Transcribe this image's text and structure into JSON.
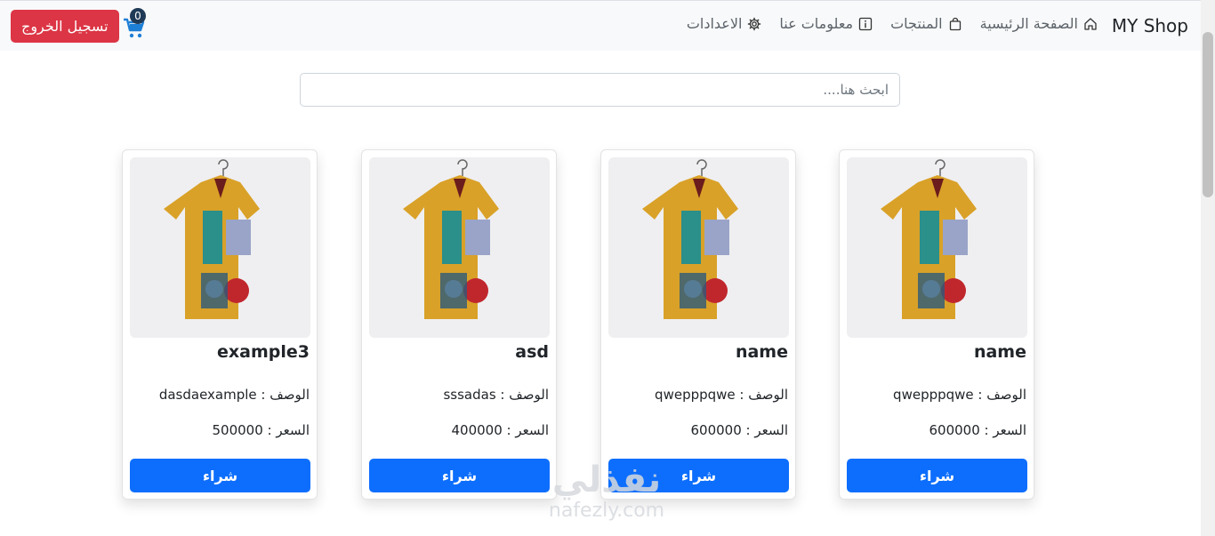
{
  "navbar": {
    "brand": "MY Shop",
    "items": [
      {
        "label": "الصفحة الرئيسية",
        "icon": "home-icon"
      },
      {
        "label": "المنتجات",
        "icon": "bag-icon"
      },
      {
        "label": "معلومات عنا",
        "icon": "info-icon"
      },
      {
        "label": "الاعدادات",
        "icon": "gear-icon"
      }
    ],
    "cart_count": "0",
    "logout_label": "تسجيل الخروج"
  },
  "search": {
    "placeholder": "ابحث هنا...."
  },
  "products": [
    {
      "name": "name",
      "description": "الوصف : qwepppqwe",
      "price": "السعر : 600000",
      "buy_label": "شراء"
    },
    {
      "name": "name",
      "description": "الوصف : qwepppqwe",
      "price": "السعر : 600000",
      "buy_label": "شراء"
    },
    {
      "name": "asd",
      "description": "الوصف : sssadas",
      "price": "السعر : 400000",
      "buy_label": "شراء"
    },
    {
      "name": "example3",
      "description": "الوصف : dasdaexample",
      "price": "السعر : 500000",
      "buy_label": "شراء"
    }
  ],
  "watermark": {
    "arabic": "نفذلي",
    "latin": "nafezly.com"
  },
  "colors": {
    "primary": "#0d6efd",
    "danger": "#dc3545",
    "navbar_bg": "#f8f9fa"
  }
}
